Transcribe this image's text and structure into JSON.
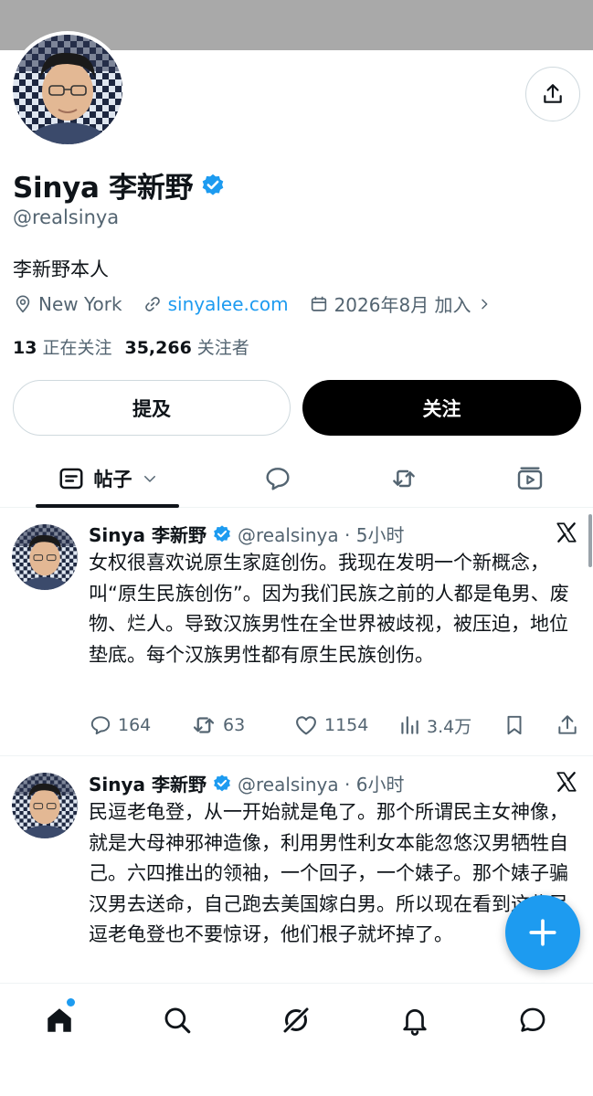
{
  "profile": {
    "name": "Sinya 李新野",
    "handle": "@realsinya",
    "bio": "李新野本人",
    "location": "New York",
    "website": "sinyalee.com",
    "joined": "2026年8月 加入",
    "following_count": "13",
    "following_label": "正在关注",
    "followers_count": "35,266",
    "followers_label": "关注者",
    "verified_color": "#1d9bf0"
  },
  "buttons": {
    "mention": "提及",
    "follow": "关注"
  },
  "tabs": {
    "posts": "帖子",
    "replies_icon": "reply-icon",
    "reposts_icon": "repost-icon",
    "media_icon": "video-icon"
  },
  "tweets": [
    {
      "name": "Sinya 李新野",
      "meta": "@realsinya · 5小时",
      "text": "女权很喜欢说原生家庭创伤。我现在发明一个新概念，叫“原生民族创伤”。因为我们民族之前的人都是龟男、废物、烂人。导致汉族男性在全世界被歧视，被压迫，地位垫底。每个汉族男性都有原生民族创伤。",
      "replies": "164",
      "reposts": "63",
      "likes": "1154",
      "views": "3.4万"
    },
    {
      "name": "Sinya 李新野",
      "meta": "@realsinya · 6小时",
      "text": "民逗老龟登，从一开始就是龟了。那个所谓民主女神像，就是大母神邪神造像，利用男性利女本能忽悠汉男牺牲自己。六四推出的领袖，一个回子，一个婊子。那个婊子骗汉男去送命，自己跑去美国嫁白男。所以现在看到这些民逗老龟登也不要惊讶，他们根子就坏掉了。"
    }
  ],
  "nav": [
    "home-icon",
    "search-icon",
    "grok-icon",
    "notifications-icon",
    "messages-icon"
  ],
  "colors": {
    "accent": "#1d9bf0",
    "text": "#0f1419",
    "muted": "#536471"
  }
}
